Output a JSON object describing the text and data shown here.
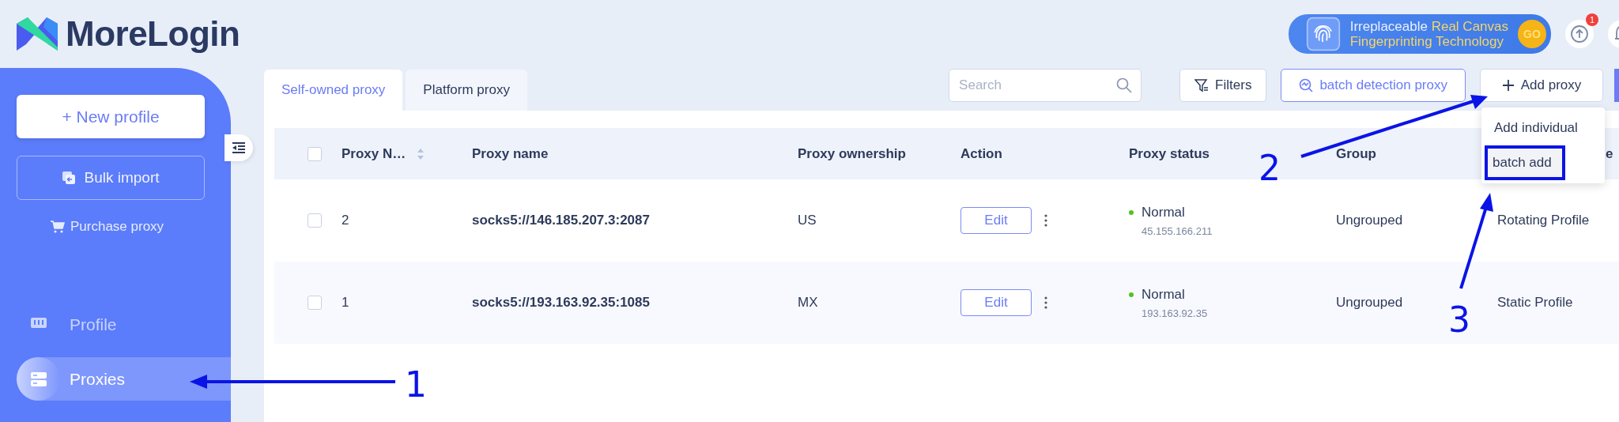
{
  "app": {
    "name": "MoreLogin"
  },
  "banner": {
    "line1_plain": "Irreplaceable",
    "line1_highlight": "Real Canvas",
    "line2": "Fingerprinting Technology",
    "button": "GO"
  },
  "header": {
    "update_badge": "1"
  },
  "sidebar": {
    "new_button": "+ New profile",
    "import_button": "Bulk import",
    "purchase_link": "Purchase proxy",
    "items": [
      {
        "label": "Profile",
        "selected": false
      },
      {
        "label": "Proxies",
        "selected": true
      }
    ]
  },
  "tabs": [
    {
      "label": "Self-owned proxy",
      "selected": true
    },
    {
      "label": "Platform proxy",
      "selected": false
    }
  ],
  "toolbar": {
    "search": {
      "placeholder": "Search"
    },
    "filters": "Filters",
    "detect": "batch detection proxy",
    "add": "Add proxy"
  },
  "menu": {
    "items": [
      {
        "label": "Add individual",
        "selected": false
      },
      {
        "label": "batch add",
        "selected": true
      }
    ]
  },
  "table": {
    "all_checked": false,
    "columns": [
      "Proxy N…",
      "Proxy name",
      "Proxy ownership",
      "Action",
      "Proxy status",
      "Group",
      "e"
    ],
    "rows": [
      {
        "checked": false,
        "number": "2",
        "name": "socks5://146.185.207.3:2087",
        "ownership": "US",
        "action": "Edit",
        "status": "Normal",
        "ip": "45.155.166.211",
        "group": "Ungrouped",
        "type": "Rotating Profile"
      },
      {
        "checked": false,
        "number": "1",
        "name": "socks5://193.163.92.35:1085",
        "ownership": "MX",
        "action": "Edit",
        "status": "Normal",
        "ip": "193.163.92.35",
        "group": "Ungrouped",
        "type": "Static Profile"
      }
    ]
  },
  "annotations": [
    {
      "label": "1"
    },
    {
      "label": "2"
    },
    {
      "label": "3"
    }
  ]
}
